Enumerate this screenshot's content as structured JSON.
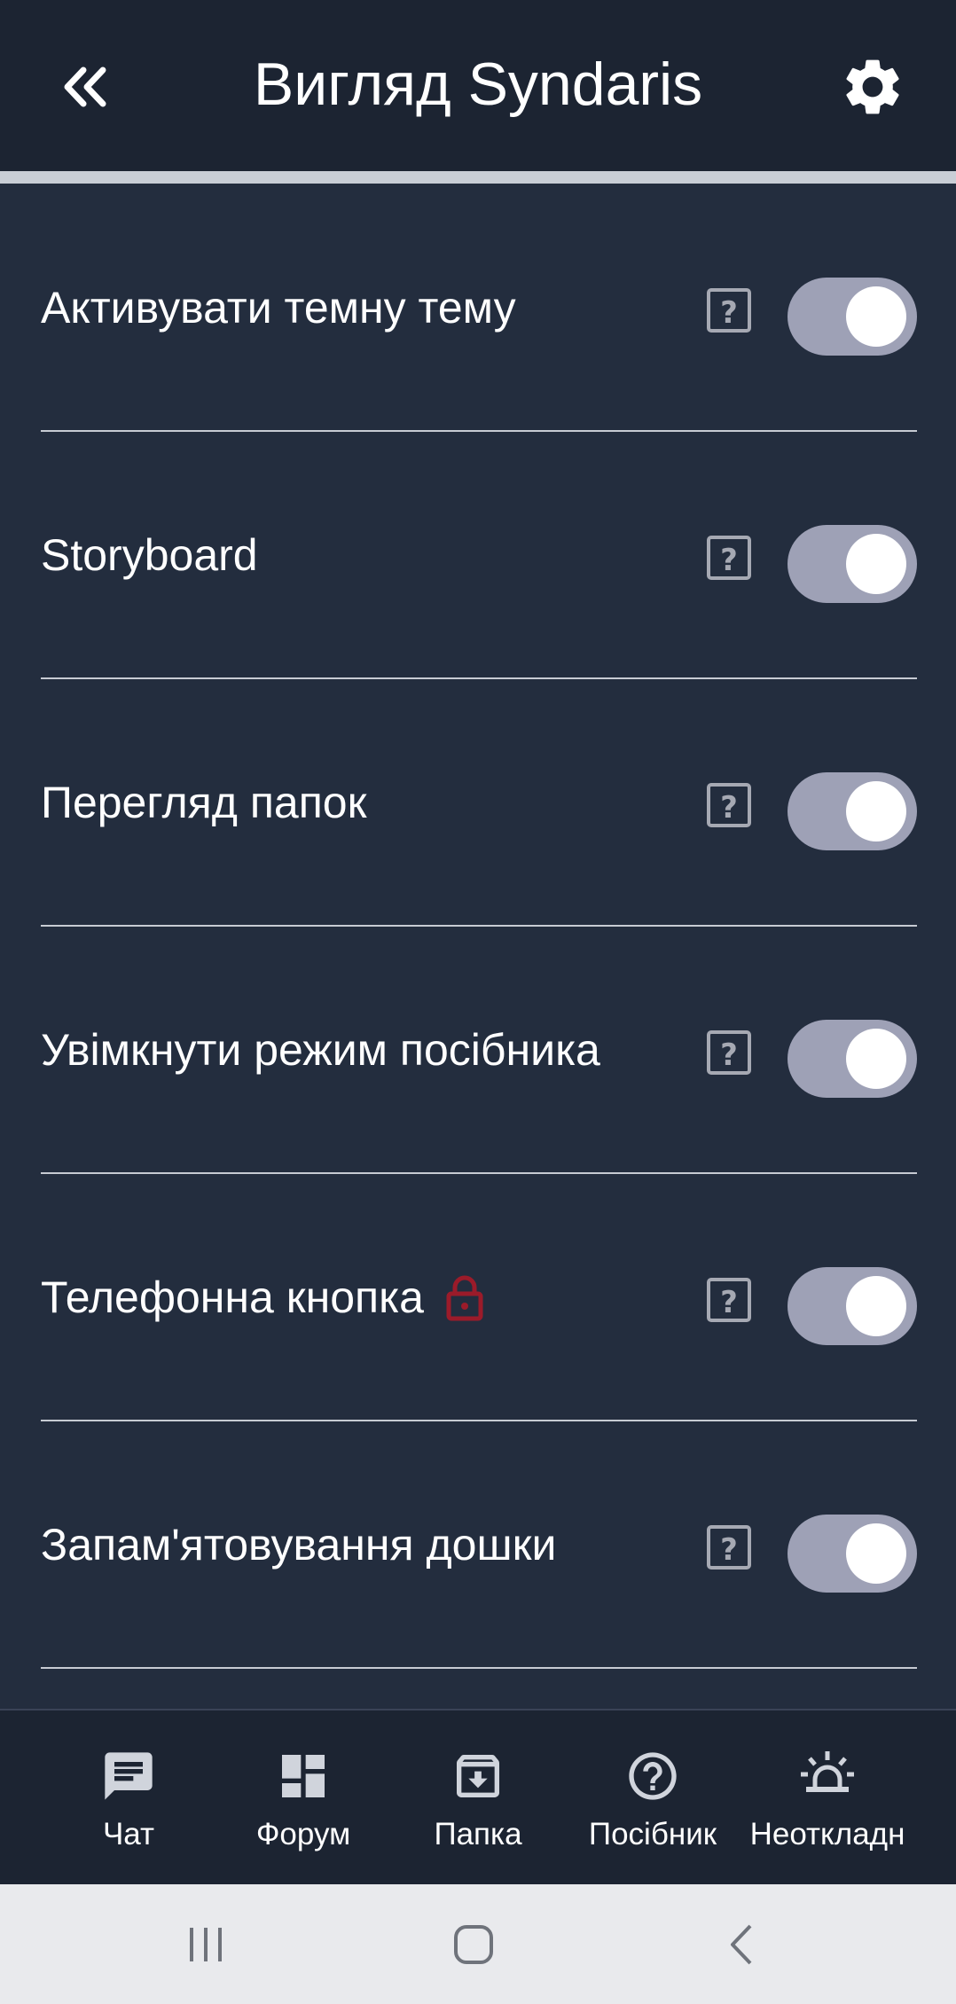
{
  "header": {
    "title": "Вигляд Syndaris",
    "back_icon": "double-chevron-left-icon",
    "settings_icon": "gear-icon"
  },
  "settings": [
    {
      "label": "Активувати темну тему",
      "enabled": true,
      "locked": false
    },
    {
      "label": "Storyboard",
      "enabled": true,
      "locked": false
    },
    {
      "label": "Перегляд папок",
      "enabled": true,
      "locked": false
    },
    {
      "label": "Увімкнути режим посібника",
      "enabled": true,
      "locked": false
    },
    {
      "label": "Телефонна кнопка",
      "enabled": true,
      "locked": true
    },
    {
      "label": "Запам'ятовування дошки",
      "enabled": true,
      "locked": false
    }
  ],
  "bottom_nav": [
    {
      "label": "Чат",
      "icon": "chat-icon"
    },
    {
      "label": "Форум",
      "icon": "dashboard-icon"
    },
    {
      "label": "Папка",
      "icon": "archive-icon"
    },
    {
      "label": "Посібник",
      "icon": "help-circle-icon"
    },
    {
      "label": "Неоткладн",
      "icon": "siren-icon"
    }
  ],
  "colors": {
    "header_bg": "#1c2432",
    "page_bg": "#232d3e",
    "toggle_track": "#9ea1b6",
    "lock_color": "#9b1b2a",
    "help_icon": "#a6a9b3"
  }
}
